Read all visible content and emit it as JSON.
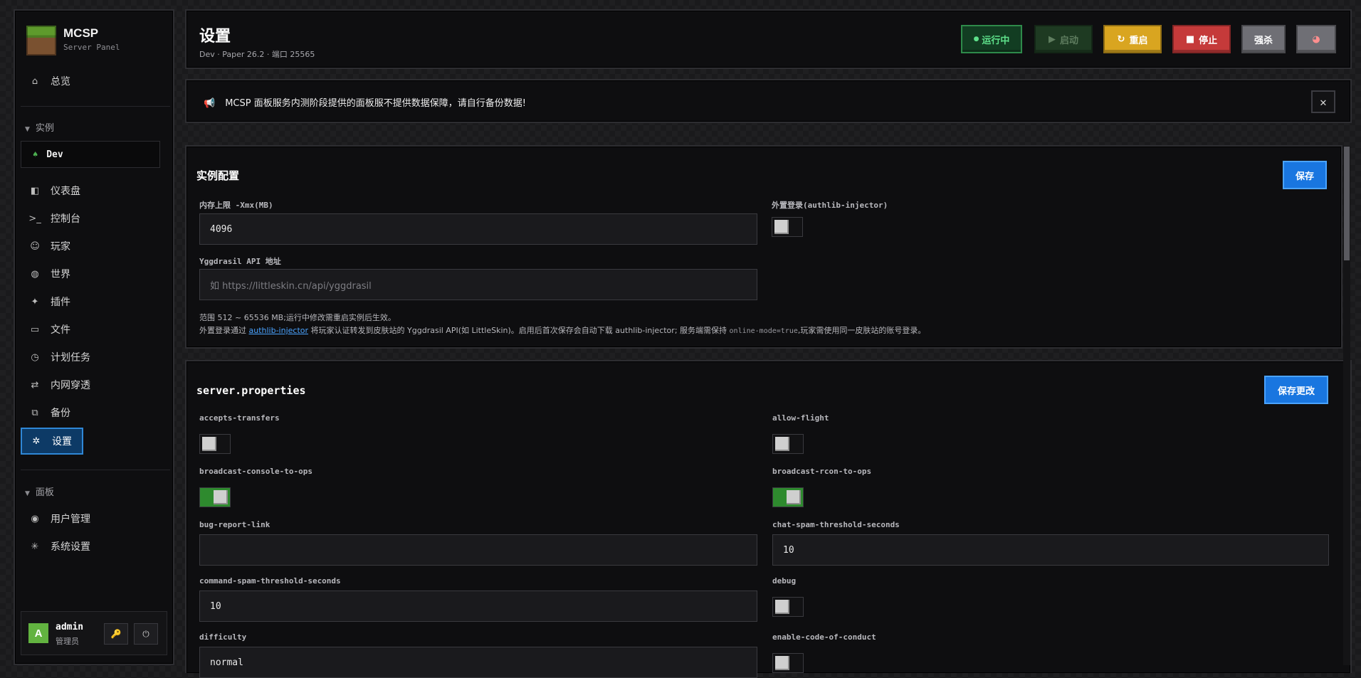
{
  "sidebar": {
    "app_name": "MCSP",
    "app_sub": "Server Panel",
    "overview": "总览",
    "instances_group": "实例",
    "instance_name": "Dev",
    "items": [
      {
        "label": "仪表盘",
        "icon": "dashboard-icon"
      },
      {
        "label": "控制台",
        "icon": "terminal-icon"
      },
      {
        "label": "玩家",
        "icon": "players-icon"
      },
      {
        "label": "世界",
        "icon": "globe-icon"
      },
      {
        "label": "插件",
        "icon": "plugin-icon"
      },
      {
        "label": "文件",
        "icon": "folder-icon"
      },
      {
        "label": "计划任务",
        "icon": "clock-icon"
      },
      {
        "label": "内网穿透",
        "icon": "tunnel-icon"
      },
      {
        "label": "备份",
        "icon": "backup-icon"
      },
      {
        "label": "设置",
        "icon": "gear-icon"
      }
    ],
    "panel_group": "面板",
    "panel_items": [
      {
        "label": "用户管理",
        "icon": "user-manage-icon"
      },
      {
        "label": "系统设置",
        "icon": "system-settings-icon"
      }
    ],
    "user": {
      "avatar_letter": "A",
      "name": "admin",
      "role": "管理员"
    }
  },
  "header": {
    "title": "设置",
    "subtitle": "Dev · Paper 26.2 · 端口 25565",
    "status": "运行中",
    "start": "启动",
    "restart": "重启",
    "stop": "停止",
    "kill": "强杀"
  },
  "notice": {
    "text": "MCSP 面板服务内测阶段提供的面板服不提供数据保障，请自行备份数据!",
    "close": "✕"
  },
  "instance_config": {
    "title": "实例配置",
    "save": "保存",
    "memory_label": "内存上限 -Xmx(MB)",
    "memory_value": "4096",
    "authlib_label": "外置登录(authlib-injector)",
    "authlib_enabled": false,
    "yggdrasil_label": "Yggdrasil API 地址",
    "yggdrasil_placeholder": "如 https://littleskin.cn/api/yggdrasil",
    "help1": "范围 512 ~ 65536 MB;运行中修改需重启实例后生效。",
    "help2_a": "外置登录通过",
    "help2_link": "authlib-injector",
    "help2_b": "将玩家认证转发到皮肤站的 Yggdrasil API(如 LittleSkin)。启用后首次保存会自动下载 authlib-injector; 服务端需保持",
    "help2_code": "online-mode=true",
    "help2_c": ",玩家需使用同一皮肤站的账号登录。"
  },
  "server_properties": {
    "title": "server.properties",
    "save": "保存更改",
    "props": {
      "accepts_transfers": {
        "label": "accepts-transfers",
        "value": false
      },
      "allow_flight": {
        "label": "allow-flight",
        "value": false
      },
      "broadcast_console_to_ops": {
        "label": "broadcast-console-to-ops",
        "value": true
      },
      "broadcast_rcon_to_ops": {
        "label": "broadcast-rcon-to-ops",
        "value": true
      },
      "bug_report_link": {
        "label": "bug-report-link",
        "value": ""
      },
      "chat_spam_threshold_seconds": {
        "label": "chat-spam-threshold-seconds",
        "value": "10"
      },
      "command_spam_threshold_seconds": {
        "label": "command-spam-threshold-seconds",
        "value": "10"
      },
      "debug": {
        "label": "debug",
        "value": false
      },
      "difficulty": {
        "label": "difficulty",
        "value": "normal"
      },
      "enable_code_of_conduct": {
        "label": "enable-code-of-conduct",
        "value": false
      }
    }
  },
  "colors": {
    "accent_blue": "#1976e0",
    "running_green": "#3ddc84",
    "restart_yellow": "#d9a520",
    "stop_red": "#c53a3a"
  }
}
